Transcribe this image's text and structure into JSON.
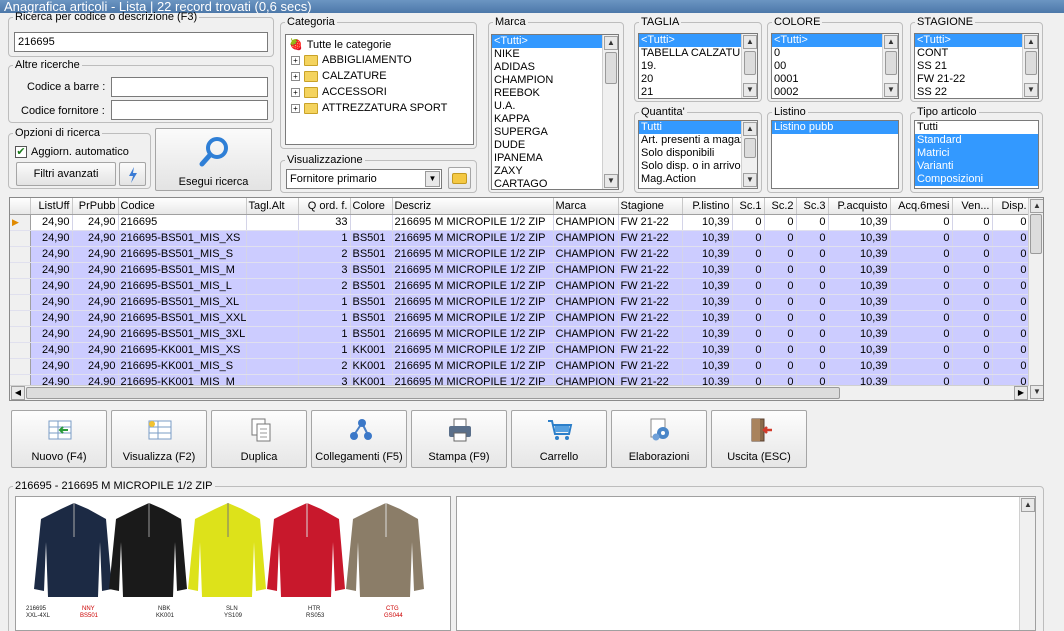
{
  "window": {
    "title": "Anagrafica articoli  - Lista | 22 record trovati (0,6 secs)"
  },
  "search": {
    "legend": "Ricerca per codice o descrizione (F3)",
    "value": "216695"
  },
  "other": {
    "legend": "Altre ricerche",
    "barcode_label": "Codice a barre :",
    "barcode_value": "",
    "supplier_label": "Codice fornitore :",
    "supplier_value": ""
  },
  "options": {
    "legend": "Opzioni di ricerca",
    "auto_update": "Aggiorn. automatico",
    "advanced_filters": "Filtri avanzati",
    "execute": "Esegui ricerca"
  },
  "category": {
    "legend": "Categoria",
    "root": "Tutte le categorie",
    "items": [
      "ABBIGLIAMENTO",
      "CALZATURE",
      "ACCESSORI",
      "ATTREZZATURA SPORT"
    ]
  },
  "view": {
    "legend": "Visualizzazione",
    "value": "Fornitore primario"
  },
  "brand": {
    "legend": "Marca",
    "items": [
      "<Tutti>",
      "NIKE",
      "ADIDAS",
      "CHAMPION",
      "REEBOK",
      "U.A.",
      "KAPPA",
      "SUPERGA",
      "DUDE",
      "IPANEMA",
      "ZAXY",
      "CARTAGO"
    ]
  },
  "size": {
    "legend": "TAGLIA",
    "items": [
      "<Tutti>",
      "TABELLA CALZATURE",
      "19.",
      "20",
      "21"
    ]
  },
  "color": {
    "legend": "COLORE",
    "items": [
      "<Tutti>",
      "0",
      "00",
      "0001",
      "0002"
    ]
  },
  "season": {
    "legend": "STAGIONE",
    "items": [
      "<Tutti>",
      "CONT",
      "SS 21",
      "FW 21-22",
      "SS 22"
    ]
  },
  "qty": {
    "legend": "Quantita'",
    "items": [
      "Tutti",
      "Art. presenti a magazzino",
      "Solo disponibili",
      "Solo disp. o in arrivo",
      "Mag.Action"
    ]
  },
  "pricelist": {
    "legend": "Listino",
    "items": [
      "Listino pubb"
    ]
  },
  "type": {
    "legend": "Tipo articolo",
    "items": [
      "Tutti",
      "Standard",
      "Matrici",
      "Varianti",
      "Composizioni"
    ]
  },
  "grid": {
    "columns": [
      "ListUff",
      "PrPubb",
      "Codice",
      "Tagl.Alt",
      "Q ord. f.",
      "Colore",
      "Descriz",
      "Marca",
      "Stagione",
      "P.listino",
      "Sc.1",
      "Sc.2",
      "Sc.3",
      "P.acquisto",
      "Acq.6mesi",
      "Ven...",
      "Disp."
    ],
    "rows": [
      [
        "24,90",
        "24,90",
        "216695",
        "",
        "33",
        "",
        "216695  M MICROPILE 1/2 ZIP",
        "CHAMPION",
        "FW 21-22",
        "10,39",
        "0",
        "0",
        "0",
        "10,39",
        "0",
        "0",
        "0"
      ],
      [
        "24,90",
        "24,90",
        "216695-BS501_MIS_XS",
        "",
        "1",
        "BS501",
        "216695  M MICROPILE 1/2 ZIP",
        "CHAMPION",
        "FW 21-22",
        "10,39",
        "0",
        "0",
        "0",
        "10,39",
        "0",
        "0",
        "0"
      ],
      [
        "24,90",
        "24,90",
        "216695-BS501_MIS_S",
        "",
        "2",
        "BS501",
        "216695  M MICROPILE 1/2 ZIP",
        "CHAMPION",
        "FW 21-22",
        "10,39",
        "0",
        "0",
        "0",
        "10,39",
        "0",
        "0",
        "0"
      ],
      [
        "24,90",
        "24,90",
        "216695-BS501_MIS_M",
        "",
        "3",
        "BS501",
        "216695  M MICROPILE 1/2 ZIP",
        "CHAMPION",
        "FW 21-22",
        "10,39",
        "0",
        "0",
        "0",
        "10,39",
        "0",
        "0",
        "0"
      ],
      [
        "24,90",
        "24,90",
        "216695-BS501_MIS_L",
        "",
        "2",
        "BS501",
        "216695  M MICROPILE 1/2 ZIP",
        "CHAMPION",
        "FW 21-22",
        "10,39",
        "0",
        "0",
        "0",
        "10,39",
        "0",
        "0",
        "0"
      ],
      [
        "24,90",
        "24,90",
        "216695-BS501_MIS_XL",
        "",
        "1",
        "BS501",
        "216695  M MICROPILE 1/2 ZIP",
        "CHAMPION",
        "FW 21-22",
        "10,39",
        "0",
        "0",
        "0",
        "10,39",
        "0",
        "0",
        "0"
      ],
      [
        "24,90",
        "24,90",
        "216695-BS501_MIS_XXL",
        "",
        "1",
        "BS501",
        "216695  M MICROPILE 1/2 ZIP",
        "CHAMPION",
        "FW 21-22",
        "10,39",
        "0",
        "0",
        "0",
        "10,39",
        "0",
        "0",
        "0"
      ],
      [
        "24,90",
        "24,90",
        "216695-BS501_MIS_3XL",
        "",
        "1",
        "BS501",
        "216695  M MICROPILE 1/2 ZIP",
        "CHAMPION",
        "FW 21-22",
        "10,39",
        "0",
        "0",
        "0",
        "10,39",
        "0",
        "0",
        "0"
      ],
      [
        "24,90",
        "24,90",
        "216695-KK001_MIS_XS",
        "",
        "1",
        "KK001",
        "216695  M MICROPILE 1/2 ZIP",
        "CHAMPION",
        "FW 21-22",
        "10,39",
        "0",
        "0",
        "0",
        "10,39",
        "0",
        "0",
        "0"
      ],
      [
        "24,90",
        "24,90",
        "216695-KK001_MIS_S",
        "",
        "2",
        "KK001",
        "216695  M MICROPILE 1/2 ZIP",
        "CHAMPION",
        "FW 21-22",
        "10,39",
        "0",
        "0",
        "0",
        "10,39",
        "0",
        "0",
        "0"
      ],
      [
        "24,90",
        "24,90",
        "216695-KK001_MIS_M",
        "",
        "3",
        "KK001",
        "216695  M MICROPILE 1/2 ZIP",
        "CHAMPION",
        "FW 21-22",
        "10,39",
        "0",
        "0",
        "0",
        "10,39",
        "0",
        "0",
        "0"
      ]
    ]
  },
  "toolbar": {
    "buttons": [
      "Nuovo (F4)",
      "Visualizza (F2)",
      "Duplica",
      "Collegamenti (F5)",
      "Stampa (F9)",
      "Carrello",
      "Elaborazioni",
      "Uscita (ESC)"
    ]
  },
  "detail": {
    "legend": "216695 - 216695  M MICROPILE 1/2 ZIP",
    "image_labels": [
      "216695\nXXL-4XL",
      "NNY\nBS501",
      "NBK\nKK001",
      "SLN\nYS109",
      "HTR\nRS053",
      "CTG\nGS044"
    ]
  },
  "colors": {
    "selection": "#3399ff",
    "grid_row": "#ccccff",
    "titlebar": "#5b86b6",
    "jacket_navy": "#1c2a44",
    "jacket_black": "#1a1a1a",
    "jacket_yellow": "#dde21a",
    "jacket_red": "#c8182c",
    "jacket_taupe": "#8b7d68"
  }
}
